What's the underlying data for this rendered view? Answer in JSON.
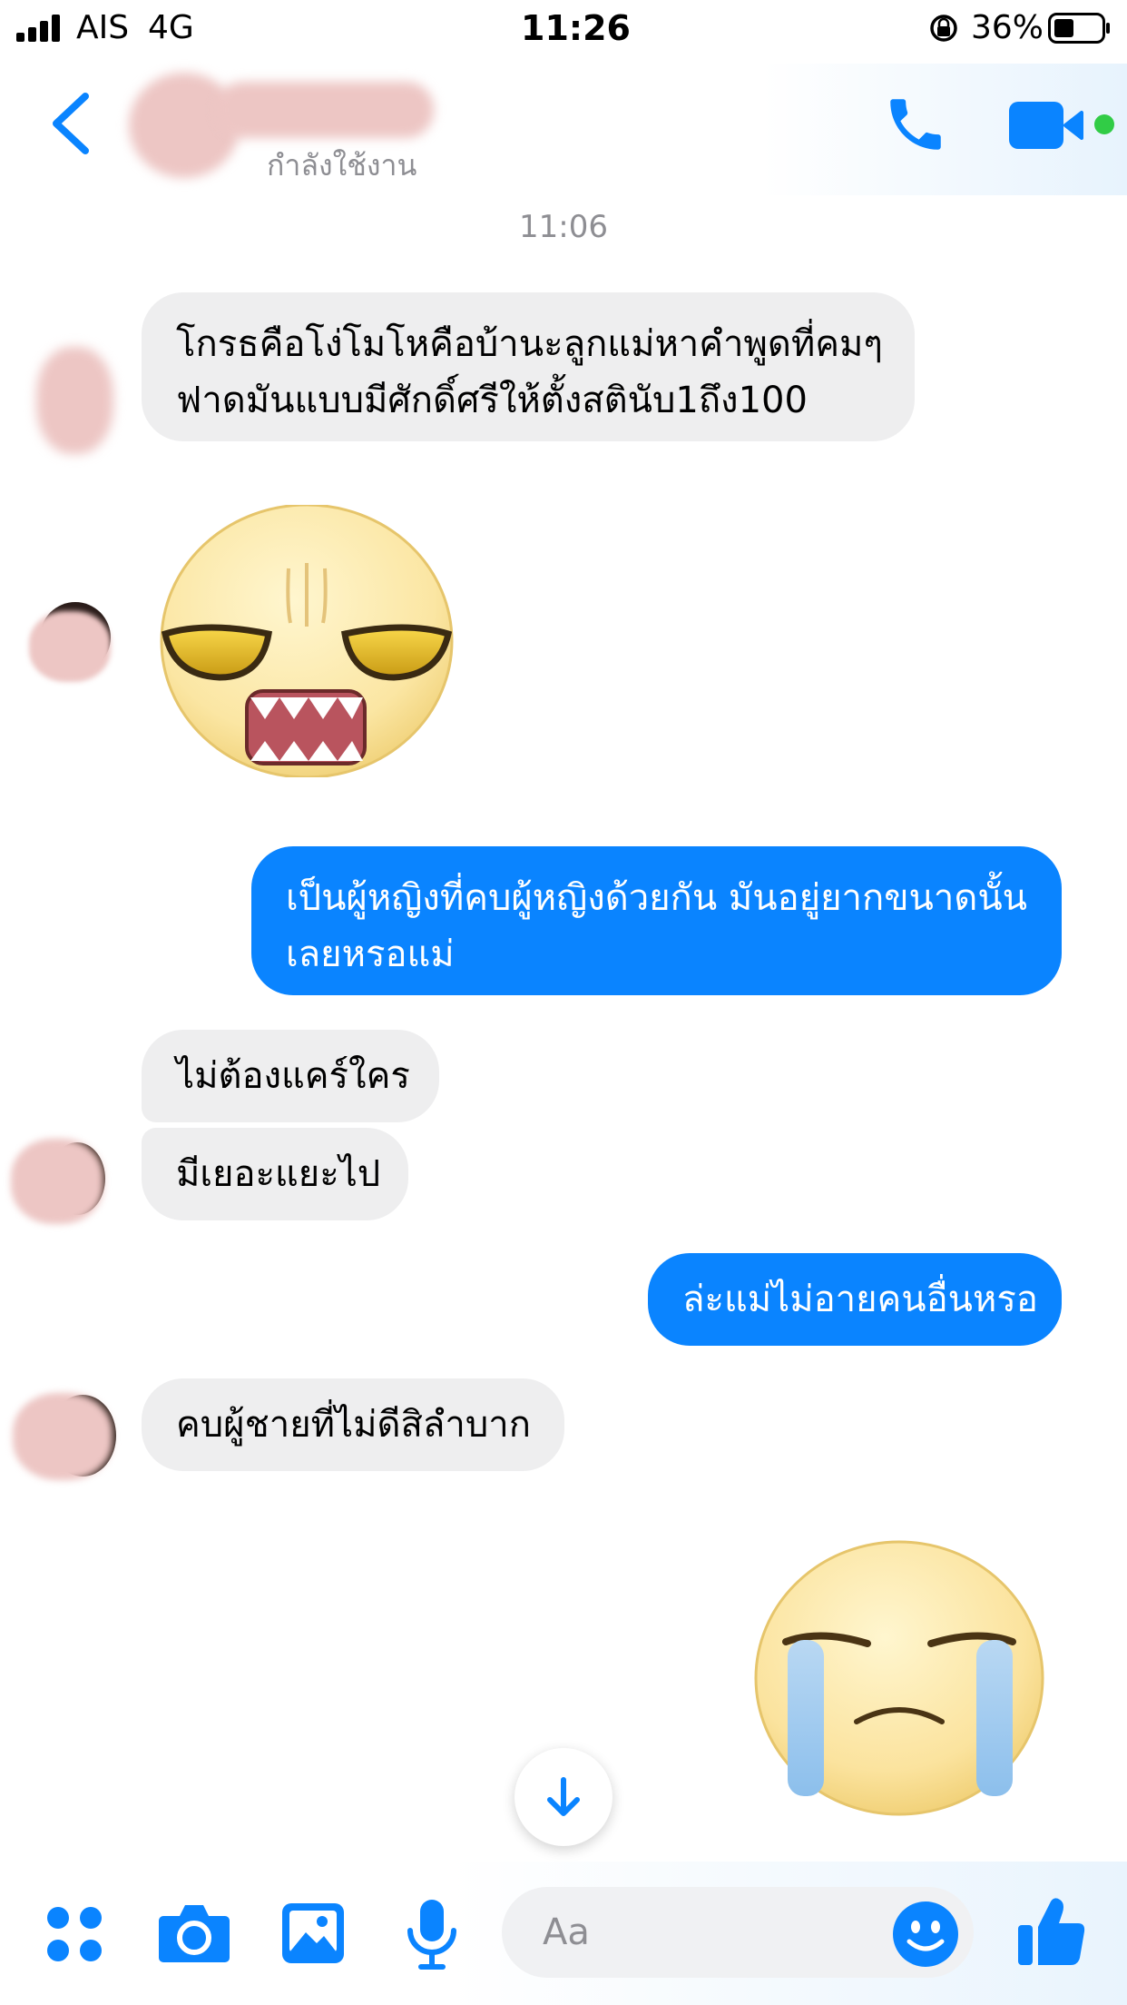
{
  "status_bar": {
    "carrier": "AIS",
    "network": "4G",
    "time": "11:26",
    "battery_percent": "36%"
  },
  "header": {
    "contact_status": "กำลังใช้งาน",
    "back_icon": "chevron-left-icon",
    "call_icon": "phone-icon",
    "video_icon": "video-camera-icon",
    "accent_color": "#0a84ff",
    "online_dot_color": "#31cc46"
  },
  "conversation": {
    "timestamp": "11:06",
    "messages": [
      {
        "from": "them",
        "lines": [
          "โกรธคือโง่โมโหคือบ้านะลูกแม่หาคำพูดที่คมๆ",
          "ฟาดมันแบบมีศักดิ์ศรีให้ตั้งสตินับ1ถึง100"
        ]
      },
      {
        "from": "them",
        "sticker": "annoyed-face-sticker"
      },
      {
        "from": "me",
        "lines": [
          "เป็นผู้หญิงที่คบผู้หญิงด้วยกัน มันอยู่ยากขนาดนั้น",
          "เลยหรอแม่"
        ]
      },
      {
        "from": "them",
        "lines": [
          "ไม่ต้องแคร์ใคร"
        ]
      },
      {
        "from": "them",
        "lines": [
          "มีเยอะแยะไป"
        ]
      },
      {
        "from": "me",
        "lines": [
          "ล่ะแม่ไม่อายคนอื่นหรอ"
        ]
      },
      {
        "from": "them",
        "lines": [
          "คบผู้ชายที่ไม่ดีสิลำบาก"
        ]
      },
      {
        "from": "me",
        "sticker": "crying-face-sticker"
      }
    ]
  },
  "composer": {
    "placeholder": "Aa",
    "icons": [
      "apps-icon",
      "camera-icon",
      "photo-icon",
      "microphone-icon",
      "emoji-icon",
      "thumbs-up-icon"
    ]
  },
  "scroll_button_icon": "arrow-down-icon"
}
